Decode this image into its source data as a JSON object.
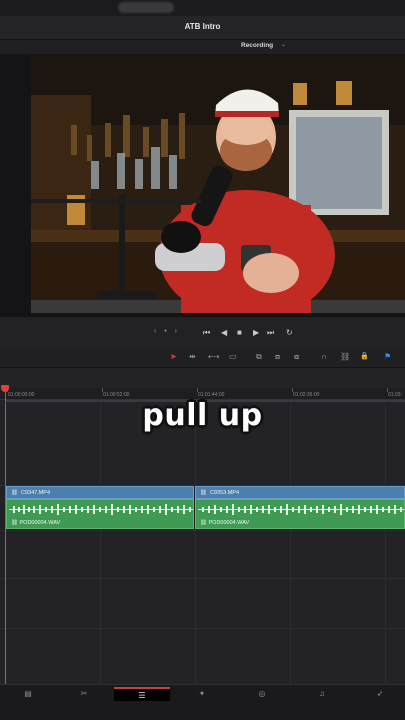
{
  "app": {
    "title": "ATB Intro"
  },
  "viewer": {
    "mode_label": "Recording"
  },
  "transport": {
    "jog_glyph": "‹ • ›",
    "buttons": [
      {
        "name": "first-frame-button",
        "glyph": "⏮"
      },
      {
        "name": "play-reverse-button",
        "glyph": "◀"
      },
      {
        "name": "stop-button",
        "glyph": "■"
      },
      {
        "name": "play-button",
        "glyph": "▶"
      },
      {
        "name": "last-frame-button",
        "glyph": "⏭"
      },
      {
        "name": "loop-button",
        "glyph": "↻"
      }
    ]
  },
  "toolbar": {
    "tools": [
      {
        "name": "selection-tool-icon",
        "glyph": "➤",
        "color": "#e0423c"
      },
      {
        "name": "trim-tool-icon",
        "glyph": "⇹"
      },
      {
        "name": "dynamic-trim-icon",
        "glyph": "⟷"
      },
      {
        "name": "blade-tool-icon",
        "glyph": "▭"
      },
      {
        "name": "insert-clip-icon",
        "glyph": "⧉"
      },
      {
        "name": "overwrite-clip-icon",
        "glyph": "⧈"
      },
      {
        "name": "replace-clip-icon",
        "glyph": "⧇"
      },
      {
        "name": "snapping-icon",
        "glyph": "∩"
      },
      {
        "name": "linked-selection-icon",
        "glyph": "⛓"
      },
      {
        "name": "position-lock-icon",
        "glyph": "🔒"
      },
      {
        "name": "flag-icon",
        "glyph": "⚑",
        "color": "#3b8df5"
      }
    ]
  },
  "timeline": {
    "ruler": [
      "01:00:00:00",
      "01:00:52:00",
      "01:01:44:00",
      "01:02:36:00",
      "01:03:"
    ],
    "caption": "pull up",
    "video_clips": [
      {
        "label": "C9347.MP4"
      },
      {
        "label": "C9353.MP4"
      }
    ],
    "audio_clips": [
      {
        "label": "POD00004.WAV"
      },
      {
        "label": "POD00004.WAV"
      }
    ]
  },
  "pages": [
    {
      "name": "page-media-icon",
      "glyph": "▤"
    },
    {
      "name": "page-cut-icon",
      "glyph": "✂"
    },
    {
      "name": "page-edit-icon",
      "glyph": "☰"
    },
    {
      "name": "page-fusion-icon",
      "glyph": "✦"
    },
    {
      "name": "page-color-icon",
      "glyph": "◎"
    },
    {
      "name": "page-fairlight-icon",
      "glyph": "♫"
    },
    {
      "name": "page-deliver-icon",
      "glyph": "➶"
    }
  ],
  "colors": {
    "accent": "#e0423c",
    "video_clip": "#4a7fae",
    "audio_clip": "#3f9b53"
  }
}
